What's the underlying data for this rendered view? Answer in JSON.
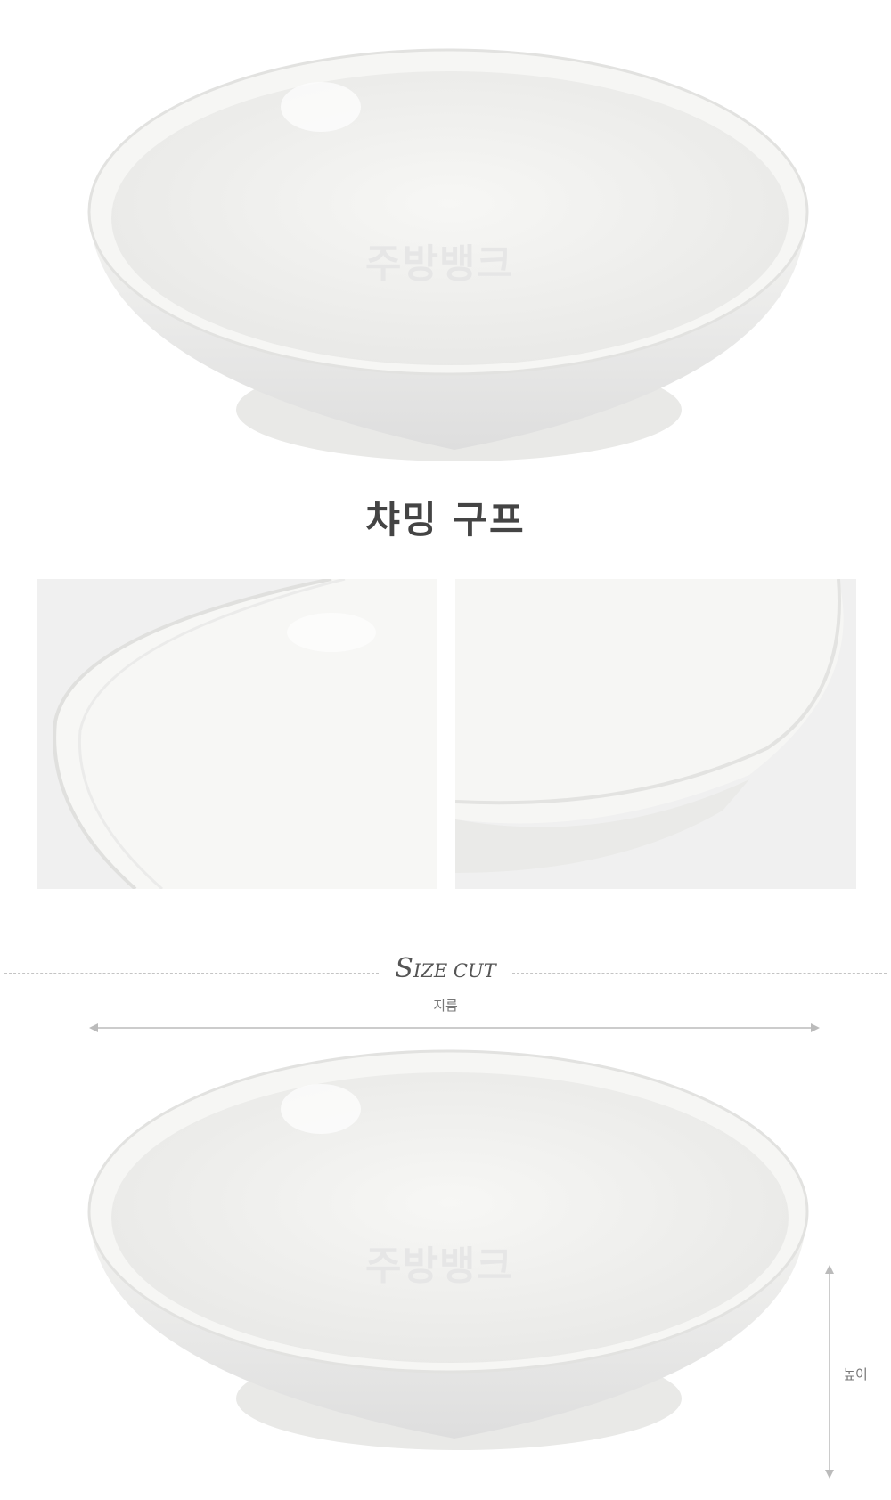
{
  "product": {
    "name": "챠밍 구프",
    "watermark_brand": "주방뱅크"
  },
  "size_cut": {
    "title_cap": "S",
    "title_rest": "IZE CUT",
    "diameter_label": "지름",
    "height_label": "높이"
  },
  "colors": {
    "background": "#ffffff",
    "panel": "#f0f0f0",
    "title_text": "#444444",
    "guide_line": "#c4c4c4"
  }
}
